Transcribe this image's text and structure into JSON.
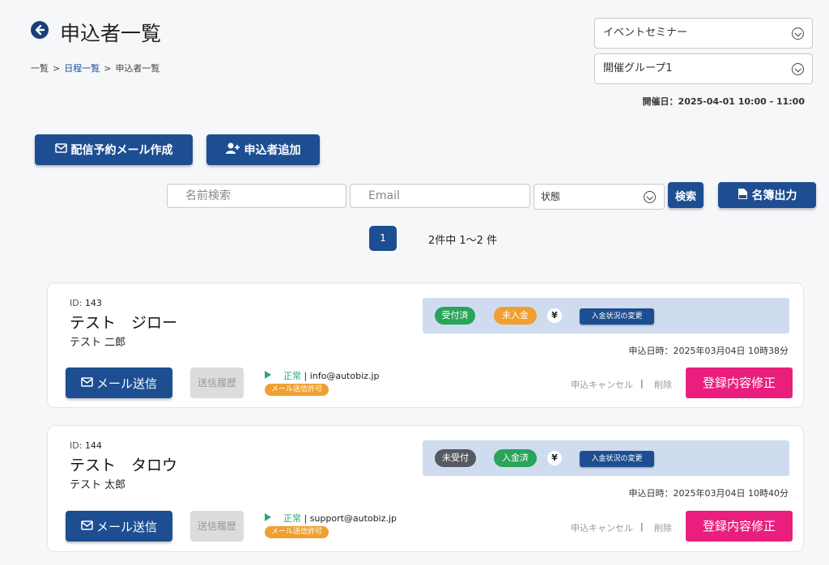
{
  "header": {
    "title": "申込者一覧",
    "breadcrumb": [
      "一覧",
      "日程一覧",
      "申込者一覧"
    ],
    "breadcrumb_sep": ">"
  },
  "selects": {
    "event": "イベントセミナー",
    "group": "開催グループ1"
  },
  "event_date": "開催日：2025-04-01 10:00 - 11:00",
  "actions": {
    "schedule_mail": "配信予約メール作成",
    "add_applicant": "申込者追加"
  },
  "search": {
    "name_placeholder": "名前検索",
    "email_placeholder": "Email",
    "status_label": "状態",
    "search_button": "検索",
    "export_button": "名簿出力"
  },
  "pagination": {
    "current_page": "1",
    "info": "2件中 1〜2 件"
  },
  "applicants": [
    {
      "id_label": "ID:",
      "id": "143",
      "name": "テスト　ジロー",
      "kana": "テスト 二郎",
      "reception_status": "受付済",
      "payment_status": "未入金",
      "yen": "¥",
      "change_payment": "入金状況の変更",
      "applied_at": "申込日時：2025年03月04日 10時38分",
      "mail_button": "メール送信",
      "history_button": "送信履歴",
      "mail_ok": "正常",
      "mail_address": " | info@autobiz.jp",
      "mail_permit": "メール送信許可",
      "cancel": "申込キャンセル",
      "divider": "|",
      "delete": "削除",
      "edit": "登録内容修正"
    },
    {
      "id_label": "ID:",
      "id": "144",
      "name": "テスト　タロウ",
      "kana": "テスト 太郎",
      "reception_status": "未受付",
      "payment_status": "入金済",
      "yen": "¥",
      "change_payment": "入金状況の変更",
      "applied_at": "申込日時：2025年03月04日 10時40分",
      "mail_button": "メール送信",
      "history_button": "送信履歴",
      "mail_ok": "正常",
      "mail_address": " | support@autobiz.jp",
      "mail_permit": "メール送信許可",
      "cancel": "申込キャンセル",
      "divider": "|",
      "delete": "削除",
      "edit": "登録内容修正"
    }
  ],
  "colors": {
    "primary": "#1d4e91",
    "accent_pink": "#e91e7d",
    "received_green": "#2aa45a",
    "unpaid_orange": "#f0a030",
    "not_received_gray": "#555a60",
    "paid_green": "#2aa45a",
    "status_panel": "#cfdcf0"
  },
  "icons": {
    "back": "back-arrow-icon",
    "mail": "envelope-icon",
    "user_add": "user-plus-icon",
    "csv": "csv-file-icon",
    "chevron": "chevron-down-circle-icon",
    "play": "play-icon"
  }
}
